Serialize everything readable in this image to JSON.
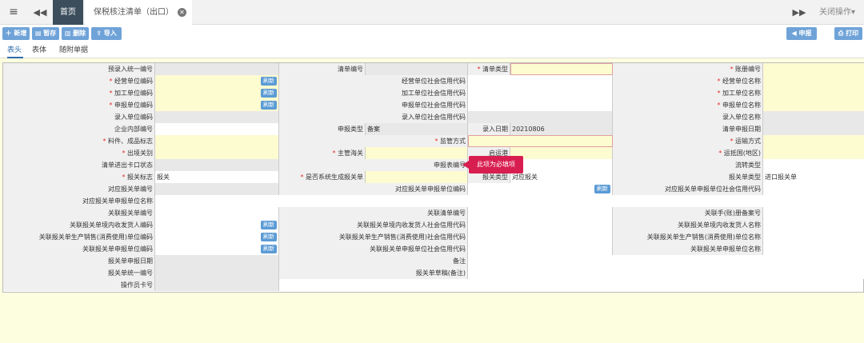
{
  "topbar": {
    "home_tab": "首页",
    "active_tab": "保税核注清单（出口）",
    "close_ops": "关闭操作▾"
  },
  "toolbar": {
    "add": "新增",
    "save": "暂存",
    "delete": "删除",
    "import": "导入",
    "declare": "申报",
    "print": "打印"
  },
  "subtabs": [
    "表头",
    "表体",
    "随附单据"
  ],
  "tooltip": "此项为必填项",
  "form": {
    "r1": {
      "l1": "预录入统一编号",
      "l2": "清单编号",
      "l3": "清单类型",
      "l4": "账册编号"
    },
    "r2": {
      "l1": "经营单位编码",
      "l2": "经营单位社会信用代码",
      "l3": "经营单位名称"
    },
    "r3": {
      "l1": "加工单位编码",
      "l2": "加工单位社会信用代码",
      "l3": "加工单位名称"
    },
    "r4": {
      "l1": "申报单位编码",
      "l2": "申报单位社会信用代码",
      "l3": "申报单位名称"
    },
    "r5": {
      "l1": "录入单位编码",
      "l2": "录入单位社会信用代码",
      "l3": "录入单位名称"
    },
    "r6": {
      "l1": "企业内部编号",
      "l2": "申报类型",
      "v2": "备案",
      "l3": "录入日期",
      "v3": "20210806",
      "l4": "清单申报日期"
    },
    "r7": {
      "l1": "料件、成品标志",
      "l2": "监管方式",
      "l3": "运输方式"
    },
    "r8": {
      "l1": "出境关别",
      "l2": "主管海关",
      "l3": "启运港",
      "l4": "运抵国(地区)"
    },
    "r9": {
      "l1": "清单进出卡口状态",
      "l2": "申报表编号",
      "l3": "流转类型"
    },
    "r10": {
      "l1": "报关标志",
      "v1": "报关",
      "l2": "是否系统生成报关单",
      "l3": "报关类型",
      "v3": "对应报关",
      "l4": "报关单类型",
      "v4": "进口报关单"
    },
    "r11": {
      "l1": "对应报关单编号",
      "l2": "对应报关单申报单位编码",
      "l3": "对应报关单申报单位社会信用代码"
    },
    "r12": {
      "l1": "对应报关单申报单位名称"
    },
    "r13": {
      "l1": "关联报关单编号",
      "l2": "关联清单编号",
      "l3": "关联手(账)册备案号"
    },
    "r14": {
      "l1": "关联报关单境内收发货人编码",
      "l2": "关联报关单境内收发货人社会信用代码",
      "l3": "关联报关单境内收发货人名称"
    },
    "r15": {
      "l1": "关联报关单生产销售(消费使用)单位编码",
      "l2": "关联报关单生产销售(消费使用)社会信用代码",
      "l3": "关联报关单生产销售(消费使用)单位名称"
    },
    "r16": {
      "l1": "关联报关单申报单位编码",
      "l2": "关联报关单申报单位社会信用代码",
      "l3": "关联报关单申报单位名称"
    },
    "r17": {
      "l1": "报关单申报日期",
      "l2": "备注"
    },
    "r18": {
      "l1": "报关单统一编号",
      "l2": "报关单草稿(备注)"
    },
    "r19": {
      "l1": "操作员卡号"
    }
  },
  "refresh_label": "刷新"
}
